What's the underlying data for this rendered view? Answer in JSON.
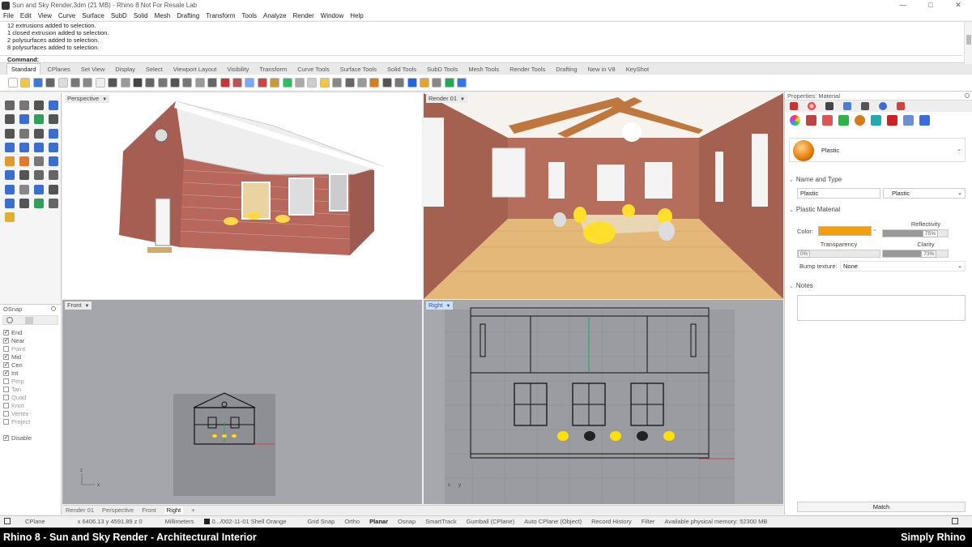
{
  "window": {
    "title": "Sun and Sky Render.3dm (21 MB) - Rhino 8 Not For Resale Lab",
    "controls": [
      "—",
      "□",
      "✕"
    ]
  },
  "menu": [
    "File",
    "Edit",
    "View",
    "Curve",
    "Surface",
    "SubD",
    "Solid",
    "Mesh",
    "Drafting",
    "Transform",
    "Tools",
    "Analyze",
    "Render",
    "Window",
    "Help"
  ],
  "command_history": [
    "12 extrusions added to selection.",
    "1 closed extrusion added to selection.",
    "2 polysurfaces added to selection.",
    "8 polysurfaces added to selection."
  ],
  "command_prompt": "Command:",
  "toolbar_tabs": [
    "Standard",
    "CPlanes",
    "Set View",
    "Display",
    "Select",
    "Viewport Layout",
    "Visibility",
    "Transform",
    "Curve Tools",
    "Surface Tools",
    "Solid Tools",
    "SubD Tools",
    "Mesh Tools",
    "Render Tools",
    "Drafting",
    "New in V8",
    "KeyShot"
  ],
  "toolbar_icon_colors": [
    "#ffffff",
    "#f3c744",
    "#3e7bd4",
    "#666666",
    "#dddddd",
    "#777777",
    "#888888",
    "#eeeeee",
    "#555555",
    "#999999",
    "#444444",
    "#666666",
    "#777777",
    "#555555",
    "#777777",
    "#999999",
    "#666666",
    "#cc3333",
    "#bb5555",
    "#77aaff",
    "#cc4444",
    "#c59a3a",
    "#2dbe60",
    "#aaaaaa",
    "#cccccc",
    "#f5c542",
    "#888888",
    "#666666",
    "#999999",
    "#d97a1c",
    "#555555",
    "#777777",
    "#2266dd",
    "#e8a030",
    "#888888",
    "#22aa55",
    "#3377ee"
  ],
  "left_tool_colors": [
    "#666666",
    "#777777",
    "#555555",
    "#3a6fd0",
    "#555555",
    "#3a6fd0",
    "#2ea05a",
    "#555555",
    "#555555",
    "#777777",
    "#555555",
    "#3a6fd0",
    "#3a6fd0",
    "#3a6fd0",
    "#3a6fd0",
    "#3a6fd0",
    "#e09b2d",
    "#e07b2d",
    "#777777",
    "#3a6fd0",
    "#3a6fd0",
    "#555555",
    "#666666",
    "#666666",
    "#3a6fd0",
    "#888888",
    "#3a6fd0",
    "#555555",
    "#3a6fd0",
    "#555555",
    "#2ea05a",
    "#666666",
    "#e0b030"
  ],
  "osnap": {
    "title": "OSnap",
    "items": [
      {
        "label": "End",
        "checked": true
      },
      {
        "label": "Near",
        "checked": true
      },
      {
        "label": "Point",
        "checked": false
      },
      {
        "label": "Mid",
        "checked": true
      },
      {
        "label": "Cen",
        "checked": true
      },
      {
        "label": "Int",
        "checked": true
      },
      {
        "label": "Perp",
        "checked": false
      },
      {
        "label": "Tan",
        "checked": false
      },
      {
        "label": "Quad",
        "checked": false
      },
      {
        "label": "Knot",
        "checked": false
      },
      {
        "label": "Vertex",
        "checked": false
      },
      {
        "label": "Project",
        "checked": false
      }
    ],
    "disable_label": "Disable"
  },
  "viewports": {
    "perspective": "Perspective",
    "render": "Render 01",
    "front": "Front",
    "right": "Right"
  },
  "viewport_tabs": [
    "Render 01",
    "Perspective",
    "Front",
    "Right"
  ],
  "viewport_tab_add": "+",
  "properties": {
    "title": "Properties: Material",
    "material_name": "Plastic",
    "name_and_type": "Name and Type",
    "name_value": "Plastic",
    "type_value": "Plastic",
    "plastic_material": "Plastic Material",
    "color_label": "Color:",
    "color": "#f59e0b",
    "reflectivity_label": "Reflectivity",
    "reflectivity": 75,
    "reflectivity_text": "75%",
    "transparency_label": "Transparency",
    "transparency": 0,
    "transparency_text": "0%",
    "clarity_label": "Clarity",
    "clarity": 73,
    "clarity_text": "73%",
    "bump_label": "Bump texture:",
    "bump_value": "None",
    "notes_label": "Notes",
    "match_label": "Match"
  },
  "status": {
    "cplane": "CPlane",
    "coords": "x 6406.13  y 4591.89  z 0",
    "units": "Millimeters",
    "layer": "0.../002-11-01 Shell Orange",
    "grid_snap": "Grid Snap",
    "ortho": "Ortho",
    "planar": "Planar",
    "osnap": "Osnap",
    "smarttrack": "SmartTrack",
    "gumball": "Gumball (CPlane)",
    "auto_cplane": "Auto CPlane (Object)",
    "record_history": "Record History",
    "filter": "Filter",
    "memory": "Available physical memory: 52300 MB"
  },
  "caption": {
    "left": "Rhino 8 - Sun and Sky Render - Architectural Interior",
    "right": "Simply Rhino"
  }
}
